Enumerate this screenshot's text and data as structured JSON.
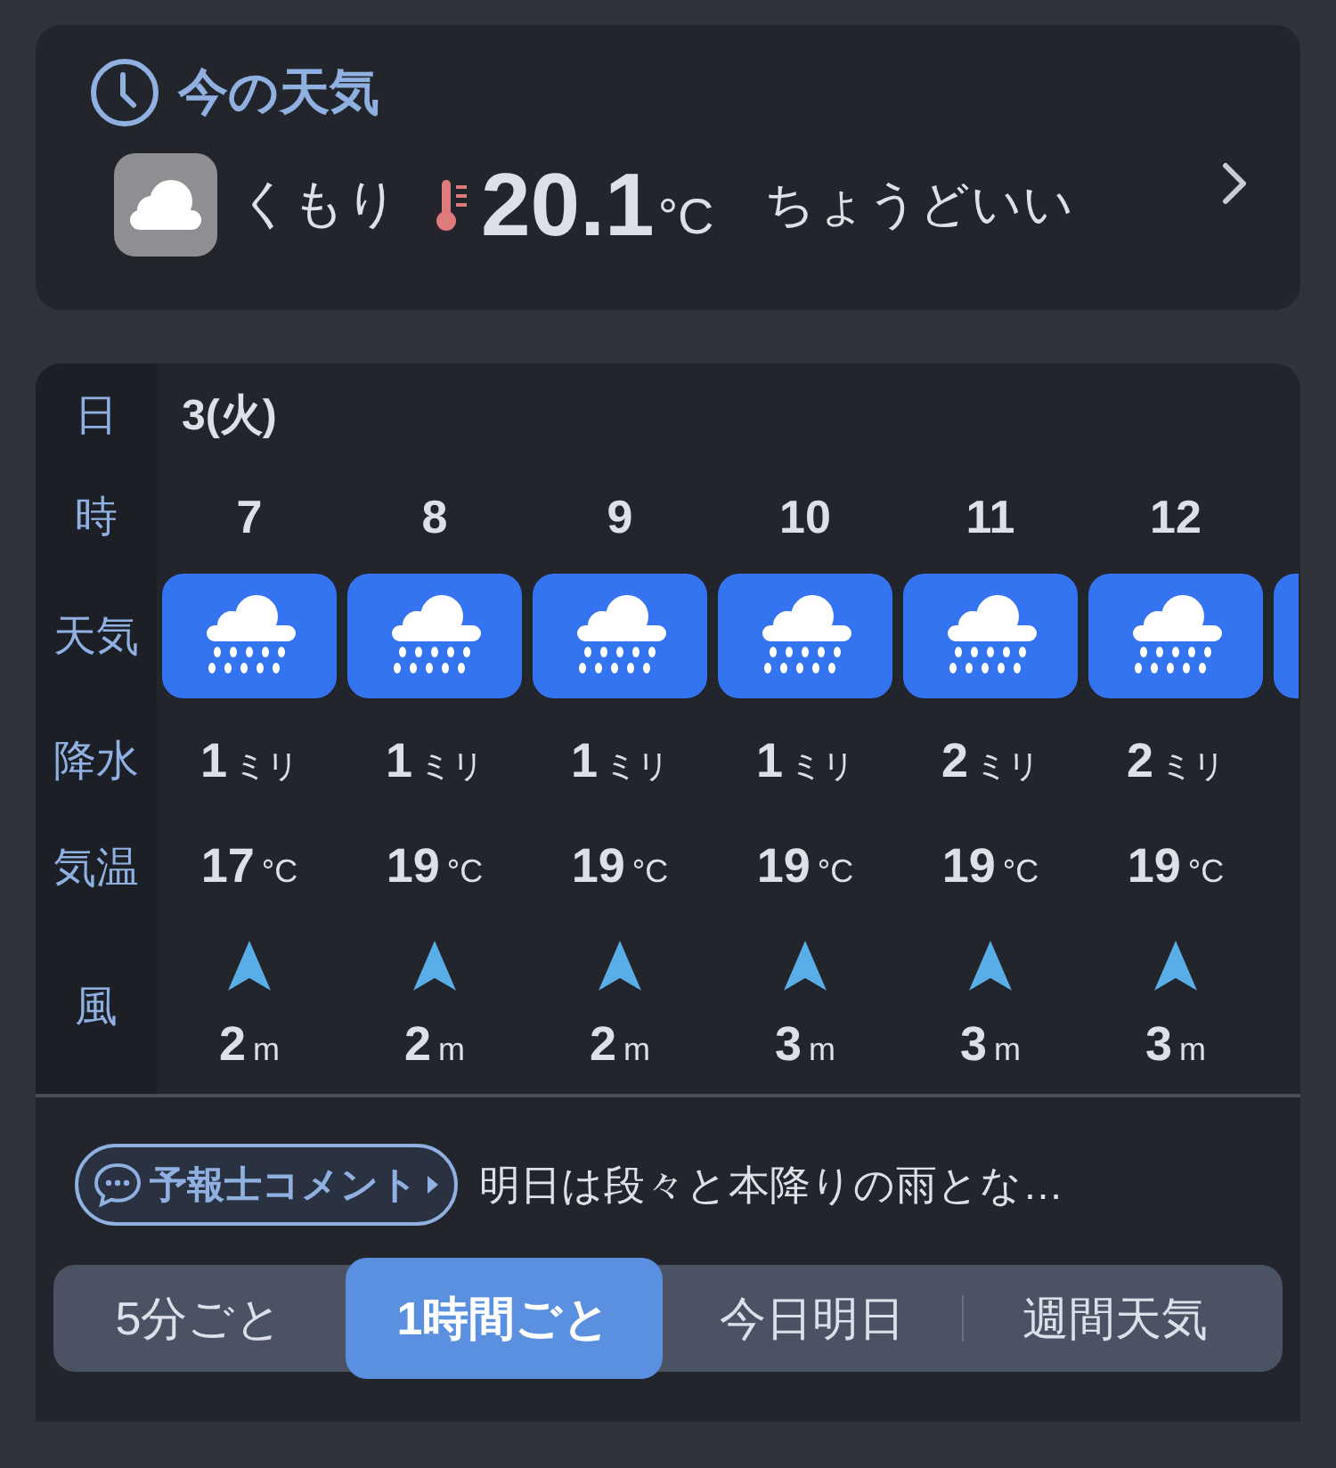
{
  "current": {
    "title": "今の天気",
    "condition": "くもり",
    "temperature": "20.1",
    "unit": "°C",
    "feeling": "ちょうどいい"
  },
  "hourly": {
    "row_labels": [
      "日",
      "時",
      "天気",
      "降水",
      "気温",
      "風"
    ],
    "date": "3(火)",
    "hours": [
      {
        "hour": "7",
        "precip": "1",
        "precip_unit": "ミリ",
        "temp": "17",
        "temp_unit": "°C",
        "wind": "2",
        "wind_unit": "m"
      },
      {
        "hour": "8",
        "precip": "1",
        "precip_unit": "ミリ",
        "temp": "19",
        "temp_unit": "°C",
        "wind": "2",
        "wind_unit": "m"
      },
      {
        "hour": "9",
        "precip": "1",
        "precip_unit": "ミリ",
        "temp": "19",
        "temp_unit": "°C",
        "wind": "2",
        "wind_unit": "m"
      },
      {
        "hour": "10",
        "precip": "1",
        "precip_unit": "ミリ",
        "temp": "19",
        "temp_unit": "°C",
        "wind": "3",
        "wind_unit": "m"
      },
      {
        "hour": "11",
        "precip": "2",
        "precip_unit": "ミリ",
        "temp": "19",
        "temp_unit": "°C",
        "wind": "3",
        "wind_unit": "m"
      },
      {
        "hour": "12",
        "precip": "2",
        "precip_unit": "ミリ",
        "temp": "19",
        "temp_unit": "°C",
        "wind": "3",
        "wind_unit": "m"
      }
    ]
  },
  "comment": {
    "badge": "予報士コメント",
    "text": "明日は段々と本降りの雨とな…"
  },
  "tabs": [
    {
      "label": "5分ごと",
      "selected": false
    },
    {
      "label": "1時間ごと",
      "selected": true
    },
    {
      "label": "今日明日",
      "selected": false
    },
    {
      "label": "週間天気",
      "selected": false
    }
  ]
}
